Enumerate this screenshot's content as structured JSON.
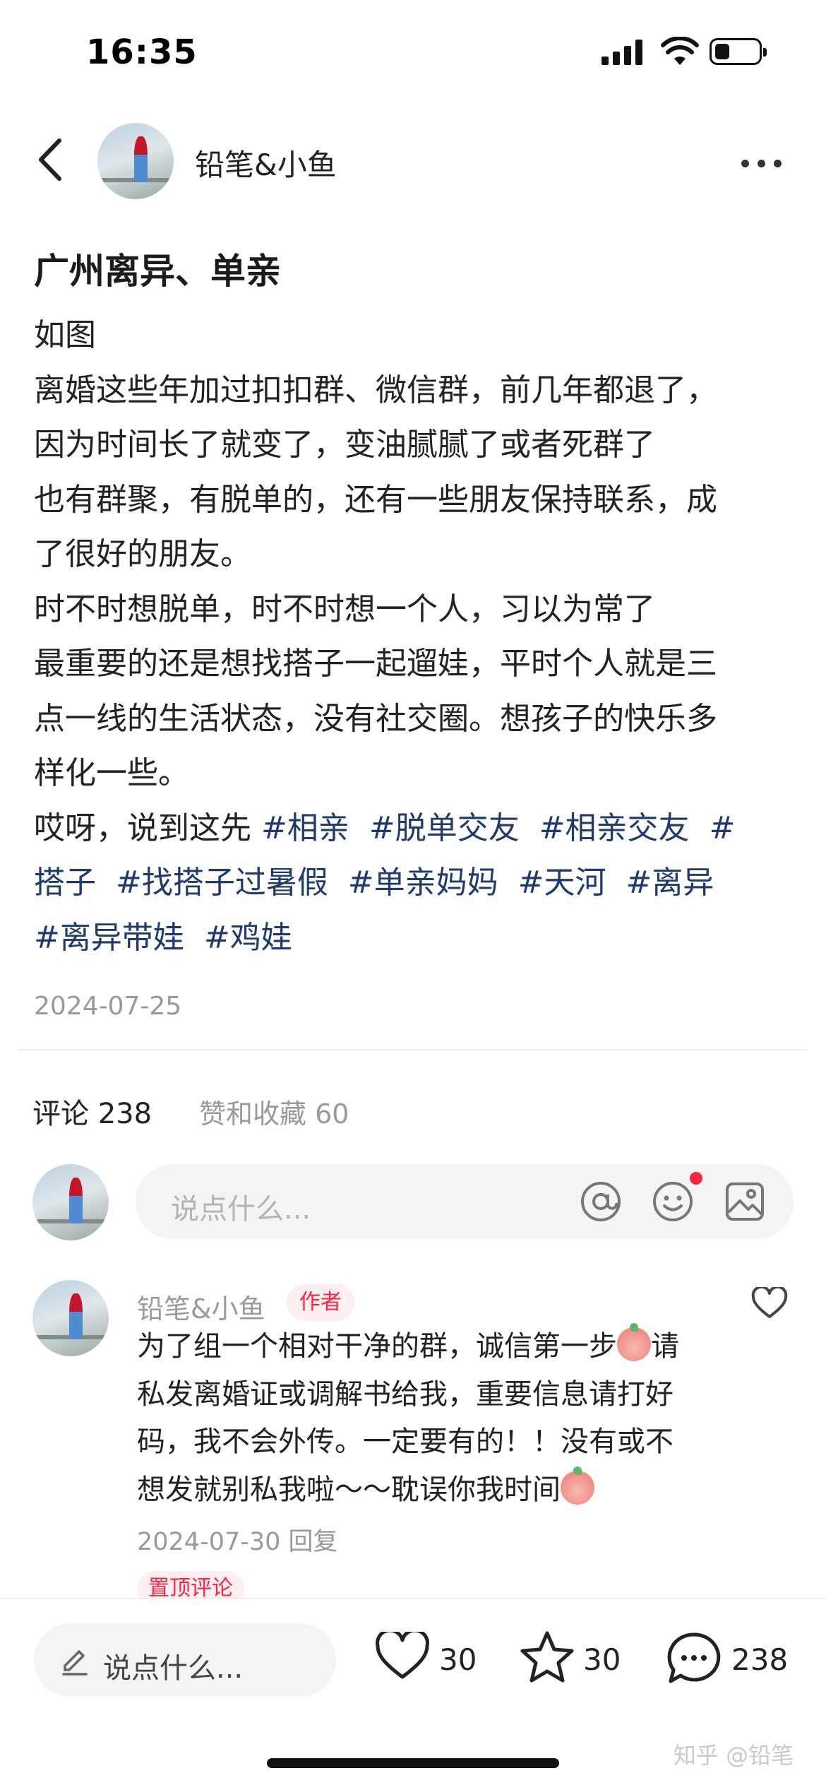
{
  "status_bar": {
    "time": "16:35"
  },
  "header": {
    "author_name": "铅笔&小鱼"
  },
  "post": {
    "title": "广州离异、单亲",
    "lines": [
      "如图",
      "离婚这些年加过扣扣群、微信群，前几年都退了，",
      "因为时间长了就变了，变油腻腻了或者死群了",
      "也有群聚，有脱单的，还有一些朋友保持联系，成",
      "了很好的朋友。",
      "时不时想脱单，时不时想一个人，习以为常了",
      "最重要的还是想找搭子一起遛娃，平时个人就是三",
      "点一线的生活状态，没有社交圈。想孩子的快乐多",
      "样化一些。"
    ],
    "tag_line_prefix": "哎呀，说到这先 ",
    "tags_line1": "#相亲  #脱单交友  #相亲交友  #",
    "tags_line2": "搭子  #找搭子过暑假  #单亲妈妈  #天河  #离异",
    "tags_line3": "#离异带娃  #鸡娃",
    "date": "2024-07-25"
  },
  "comments_header": {
    "comment_count_label": "评论 238",
    "likes_fav_label": "赞和收藏 60"
  },
  "comment_input": {
    "placeholder": "说点什么..."
  },
  "comment": {
    "author": "铅笔&小鱼",
    "badge": "作者",
    "line1": "为了组一个相对干净的群，诚信第一步",
    "line1_end": "请",
    "line2": "私发离婚证或调解书给我，重要信息请打好",
    "line3": "码，我不会外传。一定要有的！！没有或不",
    "line4": "想发就别私我啦～～耽误你我时间",
    "meta": "2024-07-30 回复",
    "pinned_label": "置顶评论"
  },
  "bottom_bar": {
    "input_placeholder": "说点什么...",
    "likes": "30",
    "favorites": "30",
    "comments": "238"
  },
  "watermark": "知乎 @铅笔",
  "colors": {
    "accent": "#ff2442",
    "tag": "#1e3a6e"
  }
}
